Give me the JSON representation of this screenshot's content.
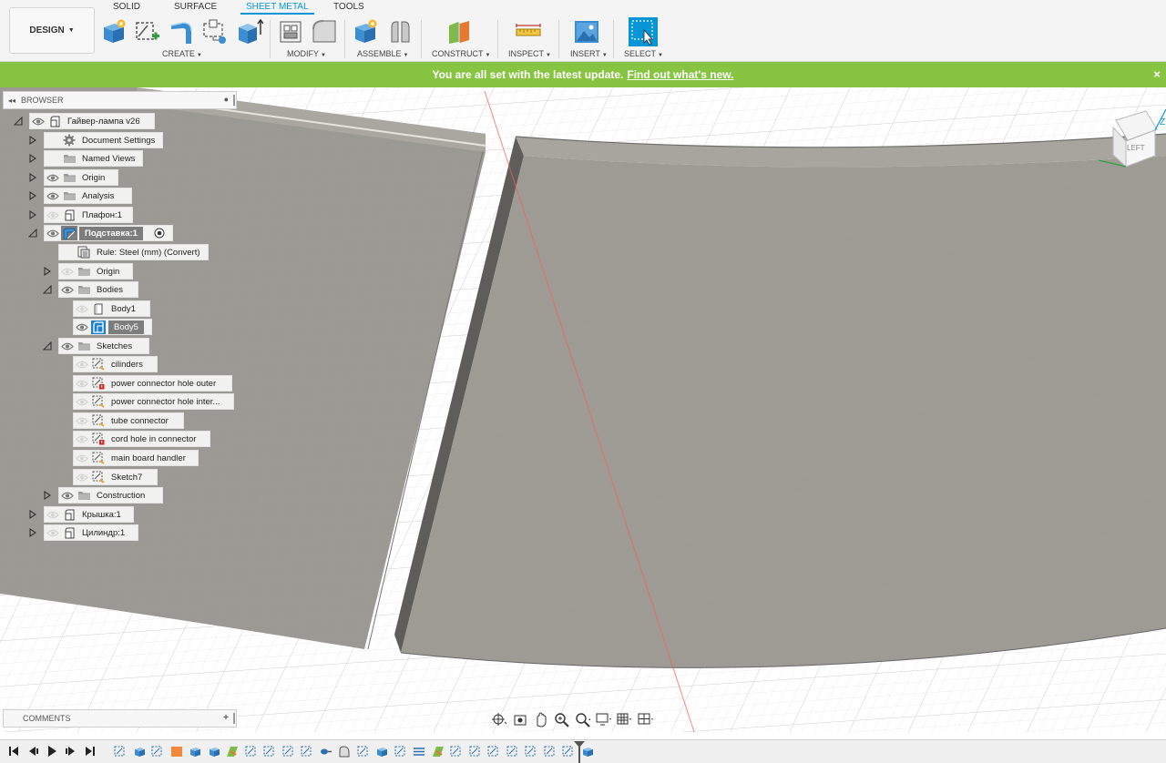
{
  "workspace": {
    "label": "DESIGN"
  },
  "tabs": [
    "SOLID",
    "SURFACE",
    "SHEET METAL",
    "TOOLS"
  ],
  "active_tab": "SHEET METAL",
  "groups": [
    "CREATE",
    "MODIFY",
    "ASSEMBLE",
    "CONSTRUCT",
    "INSPECT",
    "INSERT",
    "SELECT"
  ],
  "banner": {
    "text": "You are all set with the latest update.",
    "link": "Find out what's new.",
    "close": "×"
  },
  "browser": {
    "title": "BROWSER",
    "items": [
      {
        "label": "Гайвер-лампа v26",
        "icon": "component-icon"
      },
      {
        "label": "Document Settings",
        "icon": "gear-icon"
      },
      {
        "label": "Named Views",
        "icon": "folder-icon"
      },
      {
        "label": "Origin",
        "icon": "folder-icon"
      },
      {
        "label": "Analysis",
        "icon": "folder-icon"
      },
      {
        "label": "Плафон:1",
        "icon": "component-icon"
      },
      {
        "label": "Подставка:1",
        "icon": "sheetmetal-component-icon"
      },
      {
        "label": "Rule: Steel (mm) (Convert)",
        "icon": "rule-icon"
      },
      {
        "label": "Origin",
        "icon": "folder-icon"
      },
      {
        "label": "Bodies",
        "icon": "folder-icon"
      },
      {
        "label": "Body1",
        "icon": "body-icon"
      },
      {
        "label": "Body5",
        "icon": "sheetmetal-body-icon"
      },
      {
        "label": "Sketches",
        "icon": "folder-icon"
      },
      {
        "label": "cilinders",
        "icon": "sketch-icon"
      },
      {
        "label": "power connector hole outer",
        "icon": "sketch-warning-icon"
      },
      {
        "label": "power connector hole inter...",
        "icon": "sketch-icon"
      },
      {
        "label": "tube connector",
        "icon": "sketch-icon"
      },
      {
        "label": "cord hole in connector",
        "icon": "sketch-warning-icon"
      },
      {
        "label": "main board handler",
        "icon": "sketch-icon"
      },
      {
        "label": "Sketch7",
        "icon": "sketch-icon"
      },
      {
        "label": "Construction",
        "icon": "folder-icon"
      },
      {
        "label": "Крышка:1",
        "icon": "component-icon"
      },
      {
        "label": "Цилиндр:1",
        "icon": "component-icon"
      }
    ]
  },
  "comments": {
    "title": "COMMENTS"
  },
  "viewcube": {
    "face": "LEFT",
    "axis": "Z"
  },
  "colors": {
    "accent": "#0696d7",
    "banner": "#87c442",
    "body": "#9a9890"
  }
}
